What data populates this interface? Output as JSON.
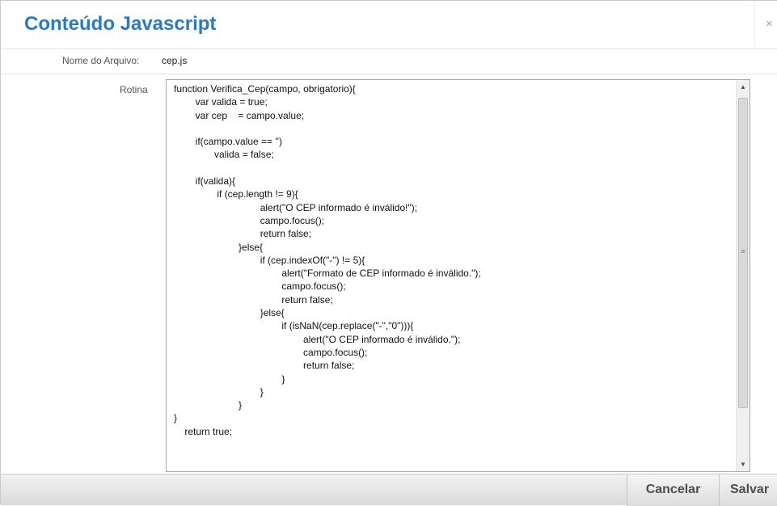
{
  "dialog": {
    "title": "Conteúdo Javascript",
    "close_label": "×"
  },
  "fields": {
    "filename_label": "Nome do Arquivo:",
    "filename_value": "cep.js",
    "routine_label": "Rotina"
  },
  "code": {
    "value": "function Verifica_Cep(campo, obrigatorio){\n        var valida = true;\n        var cep    = campo.value;\n\n        if(campo.value == '')\n               valida = false;\n\n        if(valida){\n                if (cep.length != 9){\n                                alert(\"O CEP informado é inválido!\");\n                                campo.focus();\n                                return false;\n                        }else{\n                                if (cep.indexOf(\"-\") != 5){\n                                        alert(\"Formato de CEP informado é inválido.\");\n                                        campo.focus();\n                                        return false;\n                                }else{\n                                        if (isNaN(cep.replace(\"-\",\"0\"))){\n                                                alert(\"O CEP informado é inválido.\");\n                                                campo.focus();\n                                                return false;\n                                        }\n                                }\n                        }\n}\n    return true;"
  },
  "scrollbar": {
    "up_icon": "▲",
    "down_icon": "▼",
    "grip_icon": "≡"
  },
  "footer": {
    "cancel_label": "Cancelar",
    "save_label": "Salvar"
  },
  "colors": {
    "title": "#2a7ac0"
  }
}
